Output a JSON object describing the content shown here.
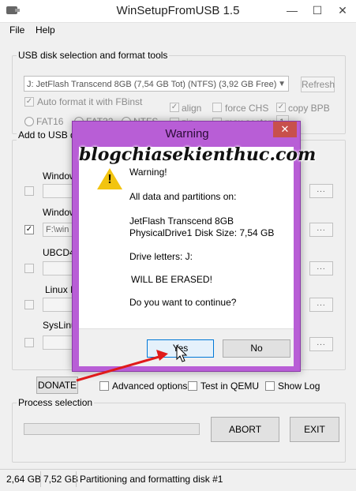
{
  "window": {
    "title": "WinSetupFromUSB 1.5",
    "minimize": "—",
    "maximize": "☐",
    "close": "✕"
  },
  "menu": {
    "file": "File",
    "help": "Help"
  },
  "usb_group": {
    "title": "USB disk selection and format tools",
    "disk_combo": "J: JetFlash Transcend 8GB (7,54 GB Tot) (NTFS) (3,92 GB Free)",
    "refresh": "Refresh",
    "auto_format": "Auto format it with FBinst",
    "align": "align",
    "force_chs": "force CHS",
    "copy_bpb": "copy BPB",
    "fat16": "FAT16",
    "fat32": "FAT32",
    "ntfs": "NTFS",
    "zip": "zip",
    "max_sectors": "max sectors",
    "sector_value": "1"
  },
  "add_group": {
    "title": "Add to USB disk",
    "row1_label": "Windows",
    "row2_label": "Windows",
    "row2_path": "F:\\win",
    "row3_label": "UBCD4Win",
    "row4_label": "Linux ISO",
    "row5_label": "SysLinux",
    "dots": "..."
  },
  "bottom": {
    "donate": "DONATE",
    "advanced": "Advanced options",
    "test_qemu": "Test in QEMU",
    "show_log": "Show Log"
  },
  "process": {
    "title": "Process selection",
    "abort": "ABORT",
    "exit": "EXIT"
  },
  "status": {
    "free": "2,64 GB",
    "total": "7,52 GB",
    "message": "Partitioning and formatting disk #1"
  },
  "dialog": {
    "title": "Warning",
    "close": "✕",
    "line1": "Warning!",
    "line2": "All data and partitions on:",
    "line3": "JetFlash Transcend 8GB",
    "line4": "PhysicalDrive1   Disk Size: 7,54 GB",
    "line5": "Drive letters:  J:",
    "line6": "WILL BE ERASED!",
    "line7": "Do you want to continue?",
    "yes": "Yes",
    "no": "No"
  },
  "watermark": "blogchiasekienthuc.com"
}
